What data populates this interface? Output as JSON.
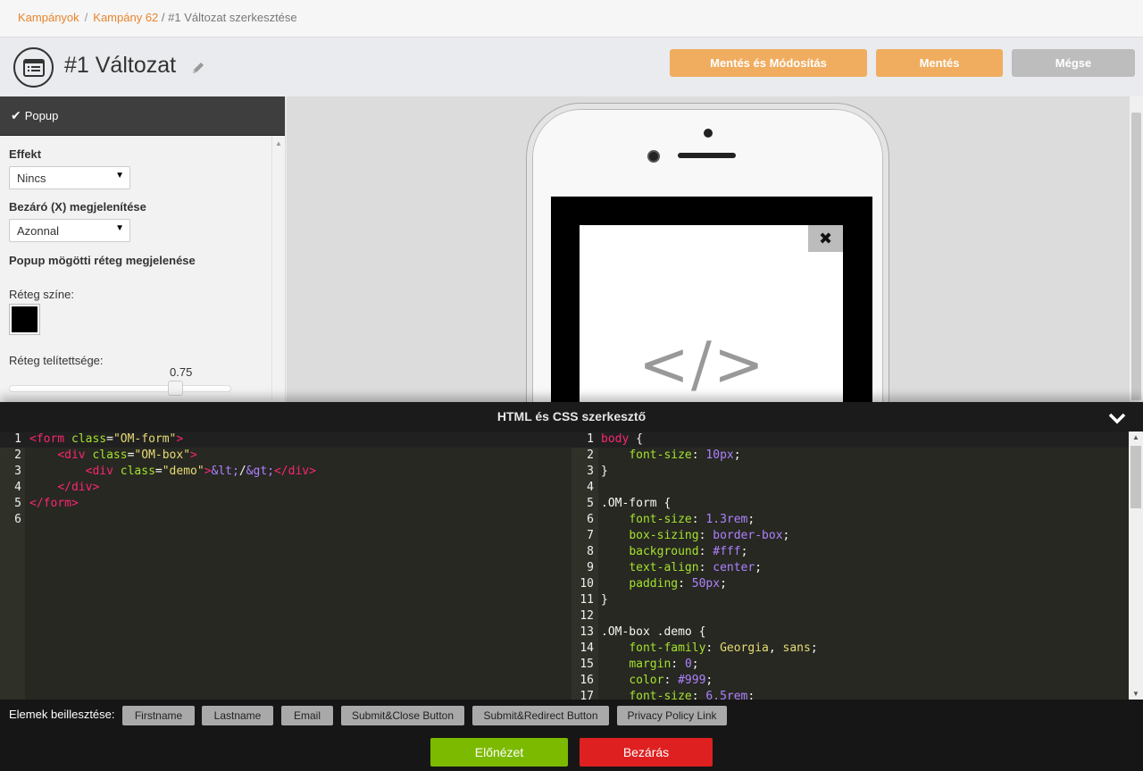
{
  "breadcrumb": {
    "item1": "Kampányok",
    "item2": "Kampány 62",
    "current": "/ #1 Változat szerkesztése",
    "sep": "/"
  },
  "header": {
    "title": "#1 Változat",
    "save_modify": "Mentés és Módosítás",
    "save": "Mentés",
    "cancel": "Mégse"
  },
  "sidebar": {
    "section": "Popup",
    "effect_label": "Effekt",
    "effect_value": "Nincs",
    "close_label": "Bezáró (X) megjelenítése",
    "close_value": "Azonnal",
    "overlay_heading": "Popup mögötti réteg megjelenése",
    "overlay_color_label": "Réteg színe:",
    "overlay_color": "#000000",
    "opacity_label": "Réteg telítettsége:",
    "opacity_value": "0.75"
  },
  "preview": {
    "close_glyph": "✖",
    "demo_text": "</>"
  },
  "editor": {
    "title": "HTML és CSS szerkesztő",
    "html_line_numbers": [
      "1",
      "2",
      "3",
      "4",
      "5",
      "6"
    ],
    "css_line_numbers": [
      "1",
      "2",
      "3",
      "4",
      "5",
      "6",
      "7",
      "8",
      "9",
      "10",
      "11",
      "12",
      "13",
      "14",
      "15",
      "16",
      "17"
    ]
  },
  "insert": {
    "label": "Elemek beillesztése:",
    "buttons": [
      "Firstname",
      "Lastname",
      "Email",
      "Submit&Close Button",
      "Submit&Redirect Button",
      "Privacy Policy Link"
    ]
  },
  "actions": {
    "preview": "Előnézet",
    "close": "Bezárás"
  }
}
